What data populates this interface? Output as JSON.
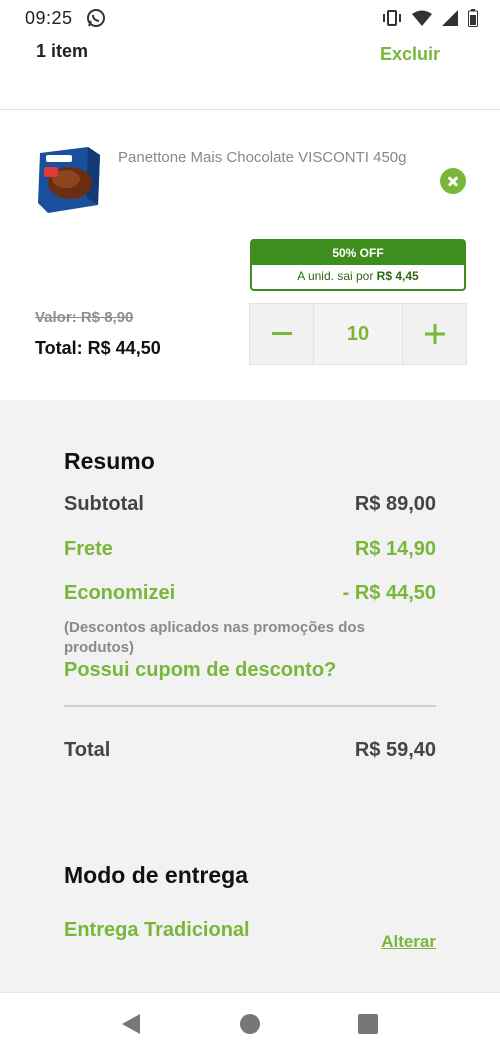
{
  "status_bar": {
    "time": "09:25"
  },
  "header": {
    "item_count": "1 item",
    "delete_label": "Excluir"
  },
  "product": {
    "name": "Panettone Mais Chocolate VISCONTI 450g",
    "promo_title": "50% OFF",
    "promo_unit_prefix": "A unid. sai por ",
    "promo_unit_price": "R$ 4,45",
    "old_value": "Valor: R$ 8,90",
    "total": "Total: R$ 44,50",
    "quantity": "10"
  },
  "summary": {
    "title": "Resumo",
    "subtotal_label": "Subtotal",
    "subtotal_value": "R$ 89,00",
    "shipping_label": "Frete",
    "shipping_value": "R$ 14,90",
    "savings_label": "Economizei",
    "savings_value": "- R$ 44,50",
    "savings_note": "(Descontos aplicados nas promoções dos produtos)",
    "coupon_link": "Possui cupom de desconto?",
    "total_label": "Total",
    "total_value": "R$ 59,40"
  },
  "delivery": {
    "title": "Modo de entrega",
    "type": "Entrega Tradicional",
    "change_label": "Alterar"
  },
  "colors": {
    "accent": "#78b73a",
    "promo_dark": "#3e8e1e"
  }
}
